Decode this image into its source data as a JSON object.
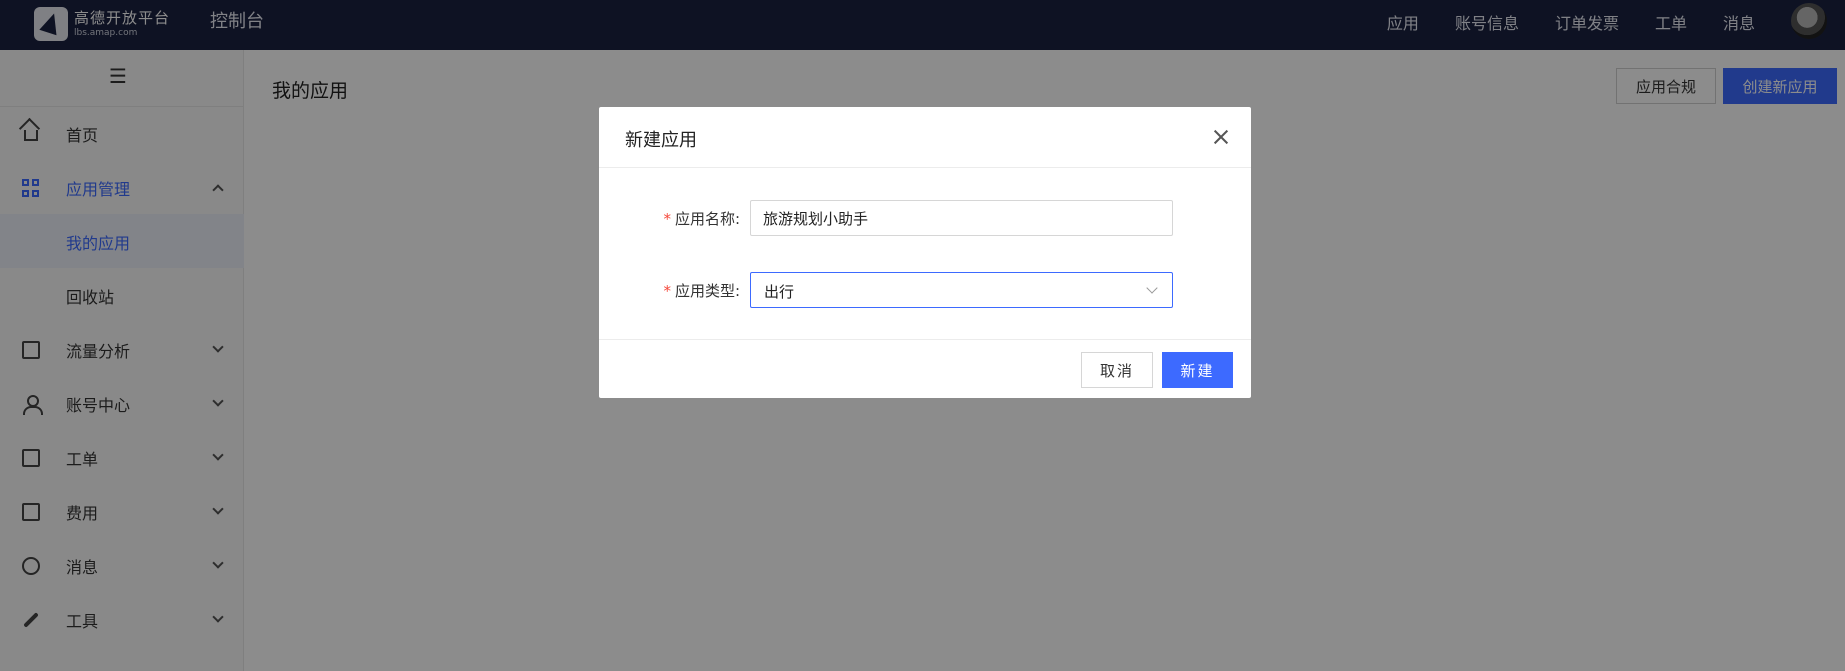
{
  "header": {
    "logo_title": "高德开放平台",
    "logo_subtitle": "lbs.amap.com",
    "console_label": "控制台",
    "nav": [
      "应用",
      "账号信息",
      "订单发票",
      "工单",
      "消息"
    ]
  },
  "sidebar": {
    "items": [
      {
        "label": "首页",
        "icon": "home-icon"
      },
      {
        "label": "应用管理",
        "icon": "grid-icon",
        "expanded": true
      },
      {
        "label": "我的应用",
        "sub": true,
        "selected": true
      },
      {
        "label": "回收站",
        "sub": true
      },
      {
        "label": "流量分析",
        "icon": "chart-icon"
      },
      {
        "label": "账号中心",
        "icon": "user-icon"
      },
      {
        "label": "工单",
        "icon": "ticket-icon"
      },
      {
        "label": "费用",
        "icon": "fee-icon"
      },
      {
        "label": "消息",
        "icon": "message-icon"
      },
      {
        "label": "工具",
        "icon": "wrench-icon"
      }
    ]
  },
  "main": {
    "title": "我的应用",
    "compliance_button": "应用合规",
    "create_button": "创建新应用"
  },
  "modal": {
    "title": "新建应用",
    "name_label": "应用名称:",
    "name_value": "旅游规划小助手",
    "type_label": "应用类型:",
    "type_value": "出行",
    "cancel_button": "取消",
    "confirm_button": "新建"
  },
  "colors": {
    "topbar": "#1b2140",
    "accent": "#3d6aff",
    "required": "#f5483b"
  }
}
